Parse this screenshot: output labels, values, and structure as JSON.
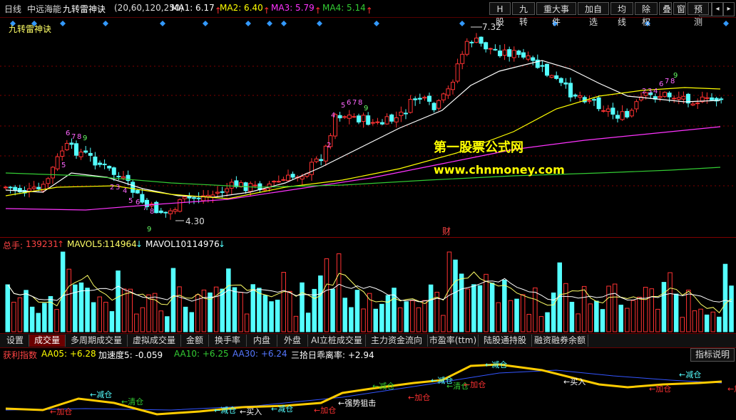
{
  "header": {
    "period": "日线",
    "stock_name": "中远海能",
    "indicator": "九转雷神诀",
    "params": "(20,60,120,250)",
    "ma": [
      {
        "label": "MA1:",
        "value": "6.17",
        "color": "#ffffff",
        "arrow": "up"
      },
      {
        "label": "MA2:",
        "value": "6.40",
        "color": "#ffff00",
        "arrow": "up"
      },
      {
        "label": "MA3:",
        "value": "5.79",
        "color": "#ff33ff",
        "arrow": "up"
      },
      {
        "label": "MA4:",
        "value": "5.14",
        "color": "#33cc33",
        "arrow": "up"
      }
    ]
  },
  "toolbar": [
    "H股",
    "九转",
    "重大事件",
    "加自选",
    "均线",
    "除权",
    "叠",
    "窗",
    "预测"
  ],
  "main_chart": {
    "title": "九转雷神诀",
    "high_label": "7.32",
    "low_label": "4.30",
    "watermark_title": "第一股票公式网",
    "watermark_url": "www.chnmoney.com",
    "finance_marker": "财"
  },
  "volume": {
    "total_label": "总手:",
    "total_value": "139231",
    "mavol5_label": "MAVOL5:",
    "mavol5_value": "114964",
    "mavol10_label": "MAVOL10:",
    "mavol10_value": "114976"
  },
  "tabs": [
    "设置",
    "成交量",
    "多周期成交量",
    "虚拟成交量",
    "金额",
    "换手率",
    "内盘",
    "外盘",
    "AI立桩成交量",
    "主力资金流向",
    "市盈率(ttm)",
    "陆股通持股",
    "融资融券余额"
  ],
  "active_tab": 1,
  "indicator_panel": {
    "name": "获利指数",
    "items": [
      {
        "label": "AA05:",
        "value": "+6.28",
        "color": "#ffff00"
      },
      {
        "label": "加速度5:",
        "value": "-0.059",
        "color": "#ffffff"
      },
      {
        "label": "AA10:",
        "value": "+6.25",
        "color": "#33cc33"
      },
      {
        "label": "AA30:",
        "value": "+6.24",
        "color": "#5577ff"
      },
      {
        "label": "三拾日乖离率:",
        "value": "+2.94",
        "color": "#ffffff"
      }
    ],
    "help_button": "指标说明",
    "signals": {
      "add": "加仓",
      "reduce": "减仓",
      "clear": "清仓",
      "buy": "买入",
      "resist": "强势狙击"
    }
  },
  "colors": {
    "up": "#ff3232",
    "down": "#54ffff",
    "grid": "#800000",
    "bg": "#000000"
  },
  "chart_data": {
    "type": "candlestick",
    "title": "九转雷神诀",
    "high": 7.32,
    "low": 4.3,
    "ma_values": {
      "MA1": 6.17,
      "MA2": 6.4,
      "MA3": 5.79,
      "MA4": 5.14
    },
    "volume_last": 139231,
    "mavol5": 114964,
    "mavol10": 114976
  }
}
